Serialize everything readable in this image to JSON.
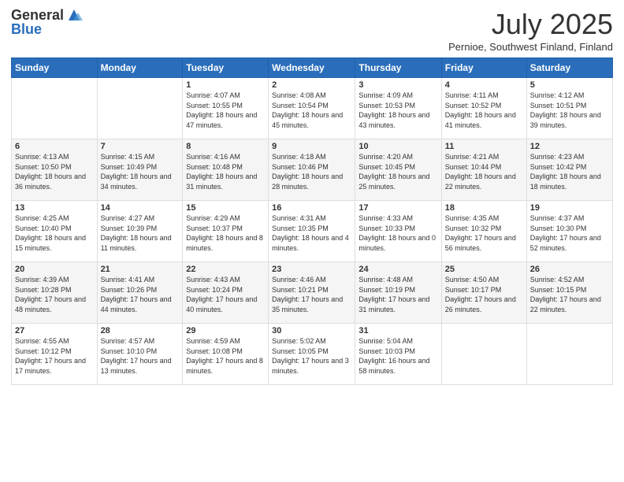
{
  "header": {
    "logo_general": "General",
    "logo_blue": "Blue",
    "month_year": "July 2025",
    "location": "Pernioe, Southwest Finland, Finland"
  },
  "days_of_week": [
    "Sunday",
    "Monday",
    "Tuesday",
    "Wednesday",
    "Thursday",
    "Friday",
    "Saturday"
  ],
  "weeks": [
    [
      {
        "day": "",
        "info": ""
      },
      {
        "day": "",
        "info": ""
      },
      {
        "day": "1",
        "info": "Sunrise: 4:07 AM\nSunset: 10:55 PM\nDaylight: 18 hours and 47 minutes."
      },
      {
        "day": "2",
        "info": "Sunrise: 4:08 AM\nSunset: 10:54 PM\nDaylight: 18 hours and 45 minutes."
      },
      {
        "day": "3",
        "info": "Sunrise: 4:09 AM\nSunset: 10:53 PM\nDaylight: 18 hours and 43 minutes."
      },
      {
        "day": "4",
        "info": "Sunrise: 4:11 AM\nSunset: 10:52 PM\nDaylight: 18 hours and 41 minutes."
      },
      {
        "day": "5",
        "info": "Sunrise: 4:12 AM\nSunset: 10:51 PM\nDaylight: 18 hours and 39 minutes."
      }
    ],
    [
      {
        "day": "6",
        "info": "Sunrise: 4:13 AM\nSunset: 10:50 PM\nDaylight: 18 hours and 36 minutes."
      },
      {
        "day": "7",
        "info": "Sunrise: 4:15 AM\nSunset: 10:49 PM\nDaylight: 18 hours and 34 minutes."
      },
      {
        "day": "8",
        "info": "Sunrise: 4:16 AM\nSunset: 10:48 PM\nDaylight: 18 hours and 31 minutes."
      },
      {
        "day": "9",
        "info": "Sunrise: 4:18 AM\nSunset: 10:46 PM\nDaylight: 18 hours and 28 minutes."
      },
      {
        "day": "10",
        "info": "Sunrise: 4:20 AM\nSunset: 10:45 PM\nDaylight: 18 hours and 25 minutes."
      },
      {
        "day": "11",
        "info": "Sunrise: 4:21 AM\nSunset: 10:44 PM\nDaylight: 18 hours and 22 minutes."
      },
      {
        "day": "12",
        "info": "Sunrise: 4:23 AM\nSunset: 10:42 PM\nDaylight: 18 hours and 18 minutes."
      }
    ],
    [
      {
        "day": "13",
        "info": "Sunrise: 4:25 AM\nSunset: 10:40 PM\nDaylight: 18 hours and 15 minutes."
      },
      {
        "day": "14",
        "info": "Sunrise: 4:27 AM\nSunset: 10:39 PM\nDaylight: 18 hours and 11 minutes."
      },
      {
        "day": "15",
        "info": "Sunrise: 4:29 AM\nSunset: 10:37 PM\nDaylight: 18 hours and 8 minutes."
      },
      {
        "day": "16",
        "info": "Sunrise: 4:31 AM\nSunset: 10:35 PM\nDaylight: 18 hours and 4 minutes."
      },
      {
        "day": "17",
        "info": "Sunrise: 4:33 AM\nSunset: 10:33 PM\nDaylight: 18 hours and 0 minutes."
      },
      {
        "day": "18",
        "info": "Sunrise: 4:35 AM\nSunset: 10:32 PM\nDaylight: 17 hours and 56 minutes."
      },
      {
        "day": "19",
        "info": "Sunrise: 4:37 AM\nSunset: 10:30 PM\nDaylight: 17 hours and 52 minutes."
      }
    ],
    [
      {
        "day": "20",
        "info": "Sunrise: 4:39 AM\nSunset: 10:28 PM\nDaylight: 17 hours and 48 minutes."
      },
      {
        "day": "21",
        "info": "Sunrise: 4:41 AM\nSunset: 10:26 PM\nDaylight: 17 hours and 44 minutes."
      },
      {
        "day": "22",
        "info": "Sunrise: 4:43 AM\nSunset: 10:24 PM\nDaylight: 17 hours and 40 minutes."
      },
      {
        "day": "23",
        "info": "Sunrise: 4:46 AM\nSunset: 10:21 PM\nDaylight: 17 hours and 35 minutes."
      },
      {
        "day": "24",
        "info": "Sunrise: 4:48 AM\nSunset: 10:19 PM\nDaylight: 17 hours and 31 minutes."
      },
      {
        "day": "25",
        "info": "Sunrise: 4:50 AM\nSunset: 10:17 PM\nDaylight: 17 hours and 26 minutes."
      },
      {
        "day": "26",
        "info": "Sunrise: 4:52 AM\nSunset: 10:15 PM\nDaylight: 17 hours and 22 minutes."
      }
    ],
    [
      {
        "day": "27",
        "info": "Sunrise: 4:55 AM\nSunset: 10:12 PM\nDaylight: 17 hours and 17 minutes."
      },
      {
        "day": "28",
        "info": "Sunrise: 4:57 AM\nSunset: 10:10 PM\nDaylight: 17 hours and 13 minutes."
      },
      {
        "day": "29",
        "info": "Sunrise: 4:59 AM\nSunset: 10:08 PM\nDaylight: 17 hours and 8 minutes."
      },
      {
        "day": "30",
        "info": "Sunrise: 5:02 AM\nSunset: 10:05 PM\nDaylight: 17 hours and 3 minutes."
      },
      {
        "day": "31",
        "info": "Sunrise: 5:04 AM\nSunset: 10:03 PM\nDaylight: 16 hours and 58 minutes."
      },
      {
        "day": "",
        "info": ""
      },
      {
        "day": "",
        "info": ""
      }
    ]
  ]
}
